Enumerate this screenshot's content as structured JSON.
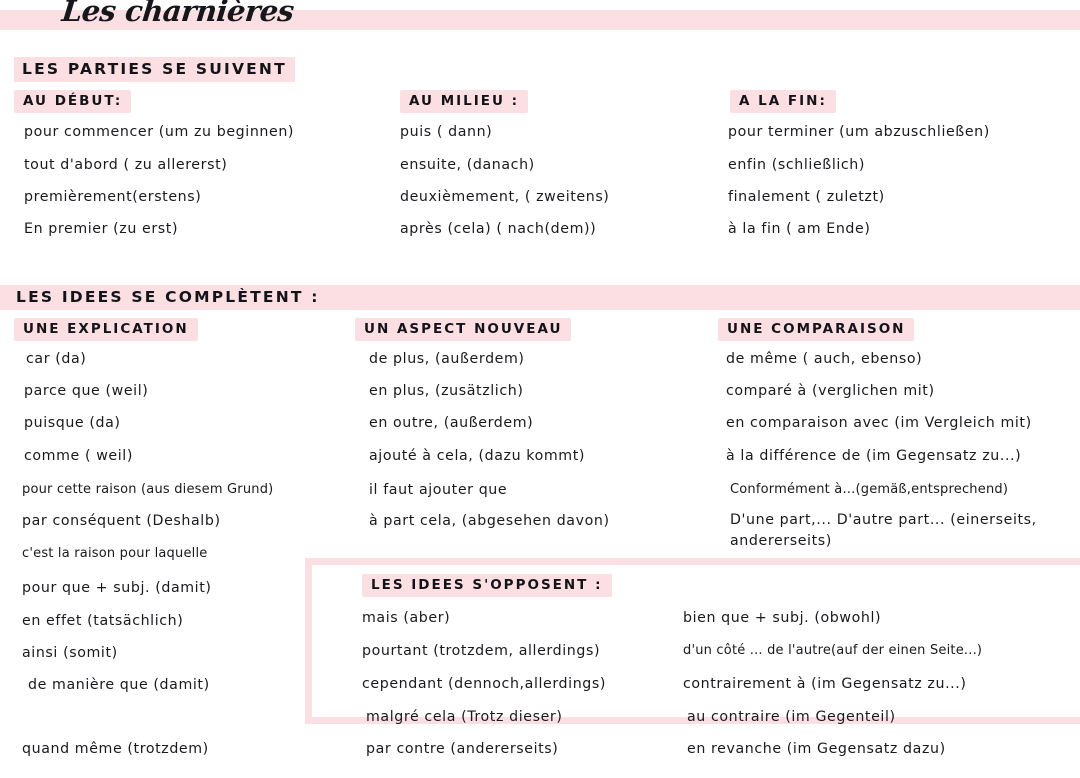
{
  "page": {
    "title": "Les charnières",
    "accent_pink": "#fbdfe3",
    "ink": "#16161a"
  },
  "sections": [
    {
      "id": "parties",
      "heading": "LES  PARTIES  SE  SUIVENT",
      "columns": [
        {
          "id": "au-debut",
          "heading": "AU DÉBUT:",
          "entries": [
            "pour  commencer  (um zu beginnen)",
            "tout  d'abord ( zu allererst)",
            "premièrement(erstens)",
            "En premier (zu erst)"
          ]
        },
        {
          "id": "au-milieu",
          "heading": "AU  MILIEU :",
          "entries": [
            "puis    ( dann)",
            "ensuite, (danach)",
            "deuxièmement, ( zweitens)",
            "après (cela)  ( nach(dem))"
          ]
        },
        {
          "id": "a-la-fin",
          "heading": "A LA FIN:",
          "entries": [
            "pour terminer (um abzuschließen)",
            "enfin (schließlich)",
            "finalement    ( zuletzt)",
            "à la fin        ( am Ende)"
          ]
        }
      ]
    },
    {
      "id": "completent",
      "heading": "LES IDEES SE COMPLÈTENT :",
      "columns": [
        {
          "id": "une-explication",
          "heading": "UNE  EXPLICATION",
          "entries": [
            "car (da)",
            "parce  que  (weil)",
            "puisque    (da)",
            "comme      ( weil)",
            "pour cette raison (aus diesem Grund)",
            "par conséquent (Deshalb)",
            "c'est la raison pour laquelle",
            "pour que + subj. (damit)",
            "en  effet (tatsächlich)",
            "ainsi   (somit)",
            "de manière que (damit)",
            "quand  même (trotzdem)"
          ]
        },
        {
          "id": "un-aspect-nouveau",
          "heading": "UN ASPECT NOUVEAU",
          "entries": [
            "de plus,  (außerdem)",
            "en plus,  (zusätzlich)",
            "en outre, (außerdem)",
            "ajouté à cela,  (dazu kommt)",
            "il faut ajouter que",
            "à part cela, (abgesehen davon)"
          ]
        },
        {
          "id": "une-comparaison",
          "heading": "UNE  COMPARAISON",
          "entries": [
            "de même  ( auch, ebenso)",
            "comparé à  (verglichen mit)",
            "en comparaison avec  (im Vergleich mit)",
            "à la différence de  (im Gegensatz zu...)",
            "Conformément à...(gemäß,entsprechend)",
            "D'une part,...  D'autre  part...\n(einerseits,  andererseits)"
          ]
        }
      ]
    },
    {
      "id": "opposent",
      "heading": "LES  IDEES    S'OPPOSENT :",
      "columns": [
        {
          "id": "opposent-left",
          "heading": "",
          "entries": [
            "mais   (aber)",
            "pourtant (trotzdem, allerdings)",
            "cependant (dennoch,allerdings)",
            "malgré cela  (Trotz  dieser)",
            "par contre (andererseits)"
          ]
        },
        {
          "id": "opposent-right",
          "heading": "",
          "entries": [
            "bien que +  subj.  (obwohl)",
            "d'un côté ... de l'autre(auf der einen Seite...)",
            "contrairement à (im Gegensatz zu...)",
            "au  contraire (im Gegenteil)",
            "en revanche  (im Gegensatz dazu)"
          ]
        }
      ]
    }
  ]
}
